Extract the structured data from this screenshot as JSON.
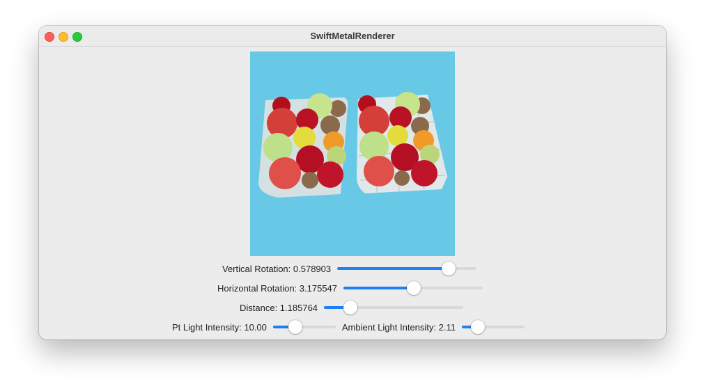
{
  "window": {
    "title": "SwiftMetalRenderer"
  },
  "controls": {
    "vertical_rotation": {
      "label": "Vertical Rotation: 0.578903",
      "fraction": 0.83
    },
    "horizontal_rotation": {
      "label": "Horizontal Rotation: 3.175547",
      "fraction": 0.505
    },
    "distance": {
      "label": "Distance: 1.185764",
      "fraction": 0.155
    },
    "pt_light_intensity": {
      "label": "Pt Light Intensity: 10.00",
      "fraction": 0.31
    },
    "ambient_light_intensity": {
      "label": "Ambient Light Intensity: 2.11",
      "fraction": 0.19
    }
  },
  "colors": {
    "accent": "#1f7ef1",
    "viewport_bg": "#68c9e6",
    "close": "#fe5f57",
    "minimize": "#febc2e",
    "maximize": "#28c840"
  }
}
